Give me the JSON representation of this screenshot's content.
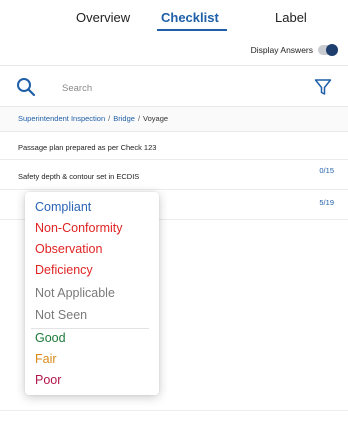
{
  "tabs": {
    "overview": "Overview",
    "checklist": "Checklist",
    "label": "Label"
  },
  "display_answers": {
    "label": "Display Answers",
    "enabled": false
  },
  "search": {
    "placeholder": "Search",
    "value": ""
  },
  "breadcrumb": {
    "crumbs": [
      "Superintendent Inspection",
      "Bridge",
      "Voyage"
    ],
    "separator": "/"
  },
  "list": {
    "items": [
      {
        "text": "Passage plan prepared as per Check 123",
        "count": ""
      },
      {
        "text": "Safety depth & contour set in ECDIS",
        "count": "0/15"
      },
      {
        "text": "",
        "count": "5/19"
      }
    ]
  },
  "dropdown": {
    "options": [
      {
        "label": "Compliant",
        "color": "#2a63b6"
      },
      {
        "label": "Non-Conformity",
        "color": "#e02424"
      },
      {
        "label": "Observation",
        "color": "#e02424"
      },
      {
        "label": "Deficiency",
        "color": "#e02424"
      },
      {
        "label": "Not Applicable",
        "color": "#7a7a7a"
      },
      {
        "label": "Not Seen",
        "color": "#7a7a7a"
      },
      {
        "label": "Good",
        "color": "#1f7a3a"
      },
      {
        "label": "Fair",
        "color": "#d98a1a"
      },
      {
        "label": "Poor",
        "color": "#b3174a"
      }
    ]
  },
  "colors": {
    "accent": "#1f5fa8",
    "toggle_knob": "#1e3f6e"
  },
  "icons": {
    "search": "search-icon",
    "filter": "filter-icon"
  }
}
